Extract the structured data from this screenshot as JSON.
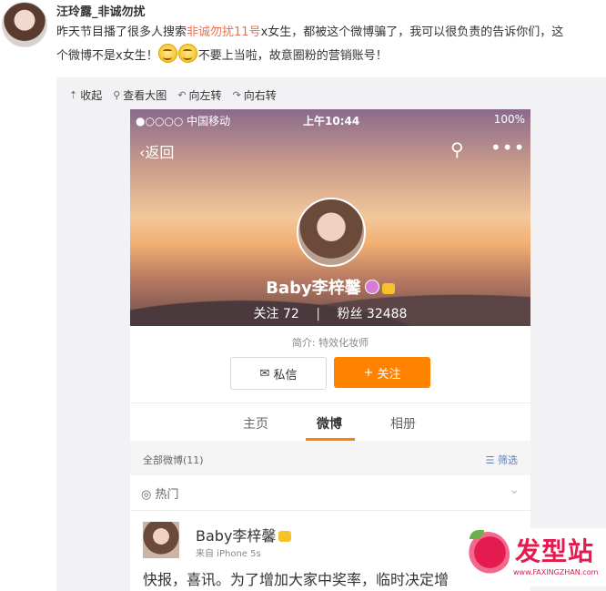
{
  "post": {
    "author": "汪玲露_非诚勿扰",
    "text_part1": "昨天节目播了很多人搜索",
    "text_highlight": "非诚勿扰11号",
    "text_part2": "x女生，都被这个微博骗了，我可以很负责的告诉你们，这",
    "text_line2_a": "个微博不是x女生！",
    "text_line2_b": "不要上当啦，故意圈粉的营销账号！"
  },
  "toolbar": {
    "collapse": "收起",
    "view_large": "查看大图",
    "rotate_left": "向左转",
    "rotate_right": "向右转"
  },
  "phone": {
    "status": {
      "carrier": "●○○○○ 中国移动",
      "time": "上午10:44",
      "battery": "100%"
    },
    "nav": {
      "back": "返回"
    },
    "profile": {
      "name": "Baby李梓馨",
      "following_label": "关注",
      "following_count": "72",
      "fans_label": "粉丝",
      "fans_count": "32488",
      "bio": "简介: 特效化妆师",
      "message_btn": "私信",
      "follow_btn": "关注"
    },
    "tabs": [
      "主页",
      "微博",
      "相册"
    ],
    "filter": {
      "all": "全部微博(11)",
      "filter": "筛选"
    },
    "hot": "热门",
    "post": {
      "author": "Baby李梓馨",
      "source": "来自 iPhone 5s",
      "body": "快报，喜讯。为了增加大家中奖率，临时决定增"
    }
  },
  "watermark": {
    "text": "发型站",
    "url": "www.FAXINGZHAN.com"
  },
  "colors": {
    "highlight": "#eb7350",
    "follow_orange": "#ff8200",
    "filter_blue": "#5d7fbe"
  }
}
